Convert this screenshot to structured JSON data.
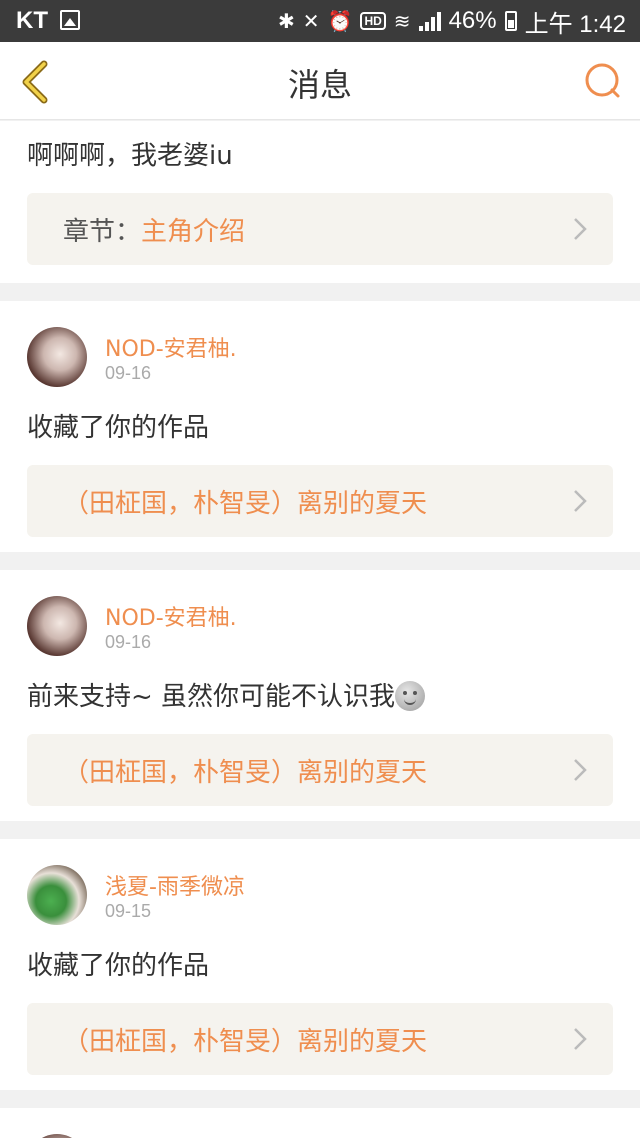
{
  "status_bar": {
    "carrier": "KT",
    "battery_text": "46%",
    "time": "上午 1:42",
    "icons": [
      "image-icon",
      "bluetooth-icon",
      "mute-icon",
      "alarm-icon",
      "hd-icon",
      "wifi-icon",
      "signal-icon",
      "battery-icon"
    ]
  },
  "nav": {
    "title": "消息",
    "back_icon": "back-chevron-icon",
    "search_icon": "search-icon",
    "accent": "#ef8e4f"
  },
  "items": [
    {
      "message": "啊啊啊，我老婆iu",
      "link_prefix": "章节：",
      "link_text": "主角介绍"
    },
    {
      "user": "NOD-安君柚.",
      "date": "09-16",
      "message": "收藏了你的作品",
      "link_text": "（田柾国，朴智旻）离别的夏天"
    },
    {
      "user": "NOD-安君柚.",
      "date": "09-16",
      "message": "前来支持~ 虽然你可能不认识我",
      "emoji": "moon-face-icon",
      "link_text": "（田柾国，朴智旻）离别的夏天"
    },
    {
      "user": "浅夏-雨季微凉",
      "date": "09-15",
      "message": "收藏了你的作品",
      "link_text": "（田柾国，朴智旻）离别的夏天"
    }
  ]
}
